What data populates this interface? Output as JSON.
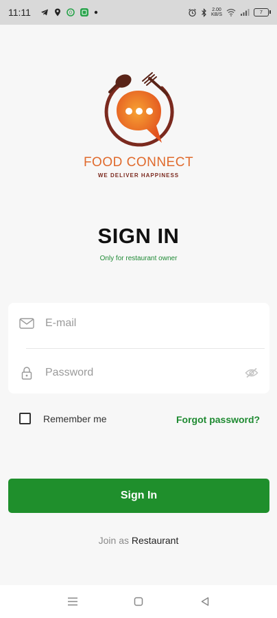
{
  "status_bar": {
    "time": "11:11",
    "net_speed_value": "2.00",
    "net_speed_unit": "KB/S",
    "battery_level": "7"
  },
  "brand": {
    "name": "FOOD CONNECT",
    "tagline": "WE DELIVER HAPPINESS",
    "primary_color": "#e06a2c",
    "secondary_color": "#7b2a1f"
  },
  "page": {
    "title": "SIGN IN",
    "subtitle": "Only for restaurant owner"
  },
  "form": {
    "email_placeholder": "E-mail",
    "email_value": "",
    "password_placeholder": "Password",
    "password_value": "",
    "remember_label": "Remember me",
    "remember_checked": false,
    "forgot_label": "Forgot password?",
    "submit_label": "Sign In",
    "accent_color": "#1f8f2c"
  },
  "footer": {
    "join_prefix": "Join as",
    "join_link": "Restaurant"
  },
  "icons": {
    "email": "mail-icon",
    "password": "lock-icon",
    "visibility": "eye-off-icon",
    "nav_menu": "menu-icon",
    "nav_home": "square-icon",
    "nav_back": "back-triangle-icon"
  }
}
